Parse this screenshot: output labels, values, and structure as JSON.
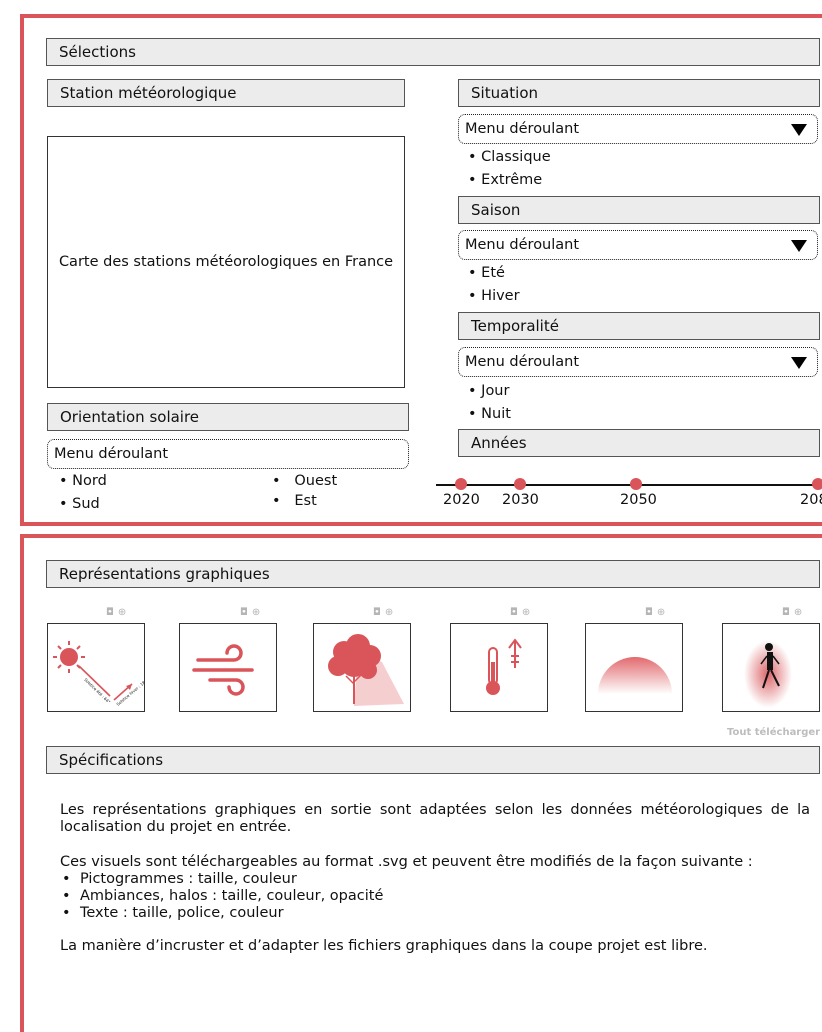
{
  "selections": {
    "header": "Sélections",
    "station": {
      "header": "Station météorologique",
      "map_caption": "Carte des stations météorologiques en France"
    },
    "orientation": {
      "header": "Orientation solaire",
      "dropdown": "Menu déroulant",
      "options_col1": [
        "• Nord",
        "• Sud"
      ],
      "options_col2": [
        "•   Ouest",
        "•   Est"
      ]
    },
    "situation": {
      "header": "Situation",
      "dropdown": "Menu déroulant",
      "options": [
        "• Classique",
        "• Extrême"
      ]
    },
    "saison": {
      "header": "Saison",
      "dropdown": "Menu déroulant",
      "options": [
        "• Eté",
        "• Hiver"
      ]
    },
    "temporalite": {
      "header": "Temporalité",
      "dropdown": "Menu déroulant",
      "options": [
        "• Jour",
        "• Nuit"
      ]
    },
    "annees": {
      "header": "Années",
      "years": [
        "2020",
        "2030",
        "2050",
        "208"
      ]
    }
  },
  "graphics": {
    "header": "Représentations graphiques",
    "tile_icons": [
      "camera-icon",
      "zoom-icon"
    ],
    "tiles": [
      "sun-path-icon",
      "wind-icon",
      "tree-shade-icon",
      "thermometer-icon",
      "ambiance-halo-icon",
      "walking-person-halo-icon"
    ],
    "sun_labels": [
      "Solstice été : 64°",
      "Solstice hiver : 18°"
    ],
    "download_all": "Tout télécharger"
  },
  "specs": {
    "header": "Spécifications",
    "para1": "Les représentations graphiques en sortie sont adaptées selon les données météorologiques de la localisation du projet en entrée.",
    "para2": "Ces visuels sont téléchargeables au format .svg et peuvent être modifiés de la façon suivante :",
    "bullets": [
      "Pictogrammes : taille, couleur",
      "Ambiances, halos : taille, couleur, opacité",
      "Texte : taille, police, couleur"
    ],
    "para3": "La manière d’incruster et d’adapter les fichiers graphiques dans la coupe projet est libre."
  },
  "colors": {
    "accent": "#d9555a",
    "bar_bg": "#ececec"
  }
}
